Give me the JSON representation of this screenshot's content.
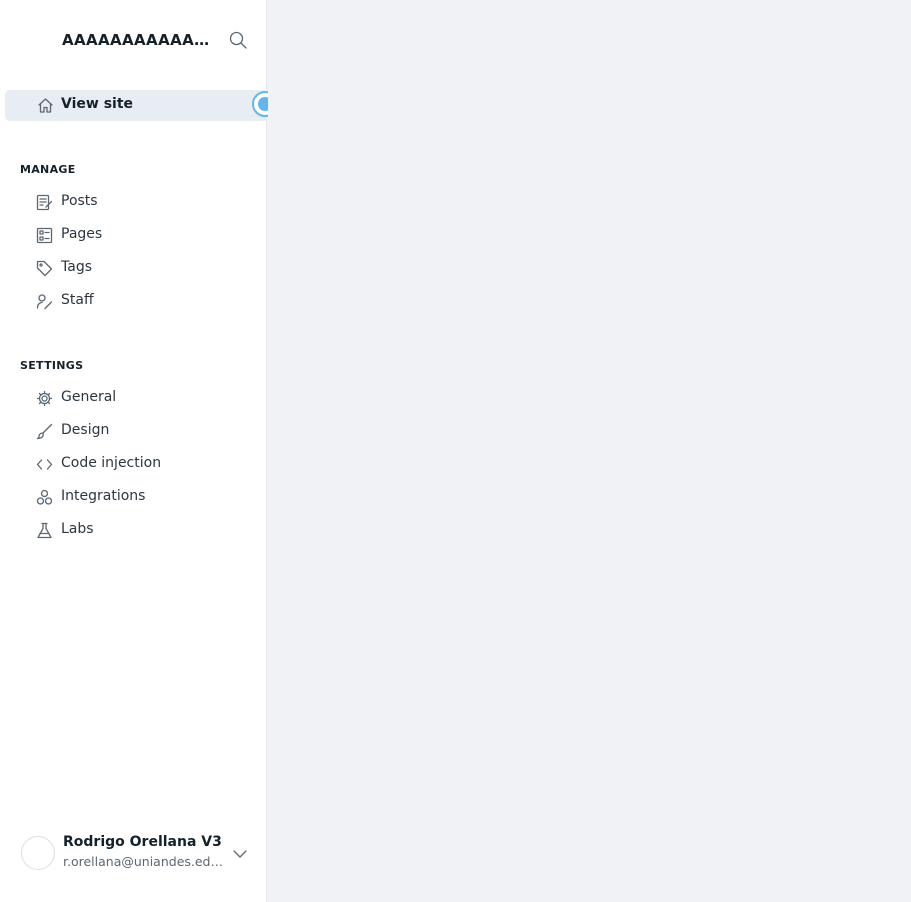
{
  "site": {
    "title": "AAAAAAAAAAAAAAAAAAAA",
    "search_icon": "search-icon"
  },
  "view_site": {
    "label": "View site",
    "icon": "home-icon"
  },
  "manage": {
    "heading": "MANAGE",
    "items": [
      {
        "label": "Posts",
        "icon": "posts-icon"
      },
      {
        "label": "Pages",
        "icon": "pages-icon"
      },
      {
        "label": "Tags",
        "icon": "tag-icon"
      },
      {
        "label": "Staff",
        "icon": "staff-icon"
      }
    ]
  },
  "settings": {
    "heading": "SETTINGS",
    "items": [
      {
        "label": "General",
        "icon": "gear-icon"
      },
      {
        "label": "Design",
        "icon": "brush-icon"
      },
      {
        "label": "Code injection",
        "icon": "code-icon"
      },
      {
        "label": "Integrations",
        "icon": "integrations-icon"
      },
      {
        "label": "Labs",
        "icon": "flask-icon"
      }
    ]
  },
  "user": {
    "name": "Rodrigo Orellana V3",
    "email": "r.orellana@uniandes.edu.co"
  },
  "colors": {
    "sidebar_bg": "#ffffff",
    "main_bg": "#f0f2f6",
    "active_bg": "#e8ecf3",
    "pulse": "#62b6ee"
  }
}
